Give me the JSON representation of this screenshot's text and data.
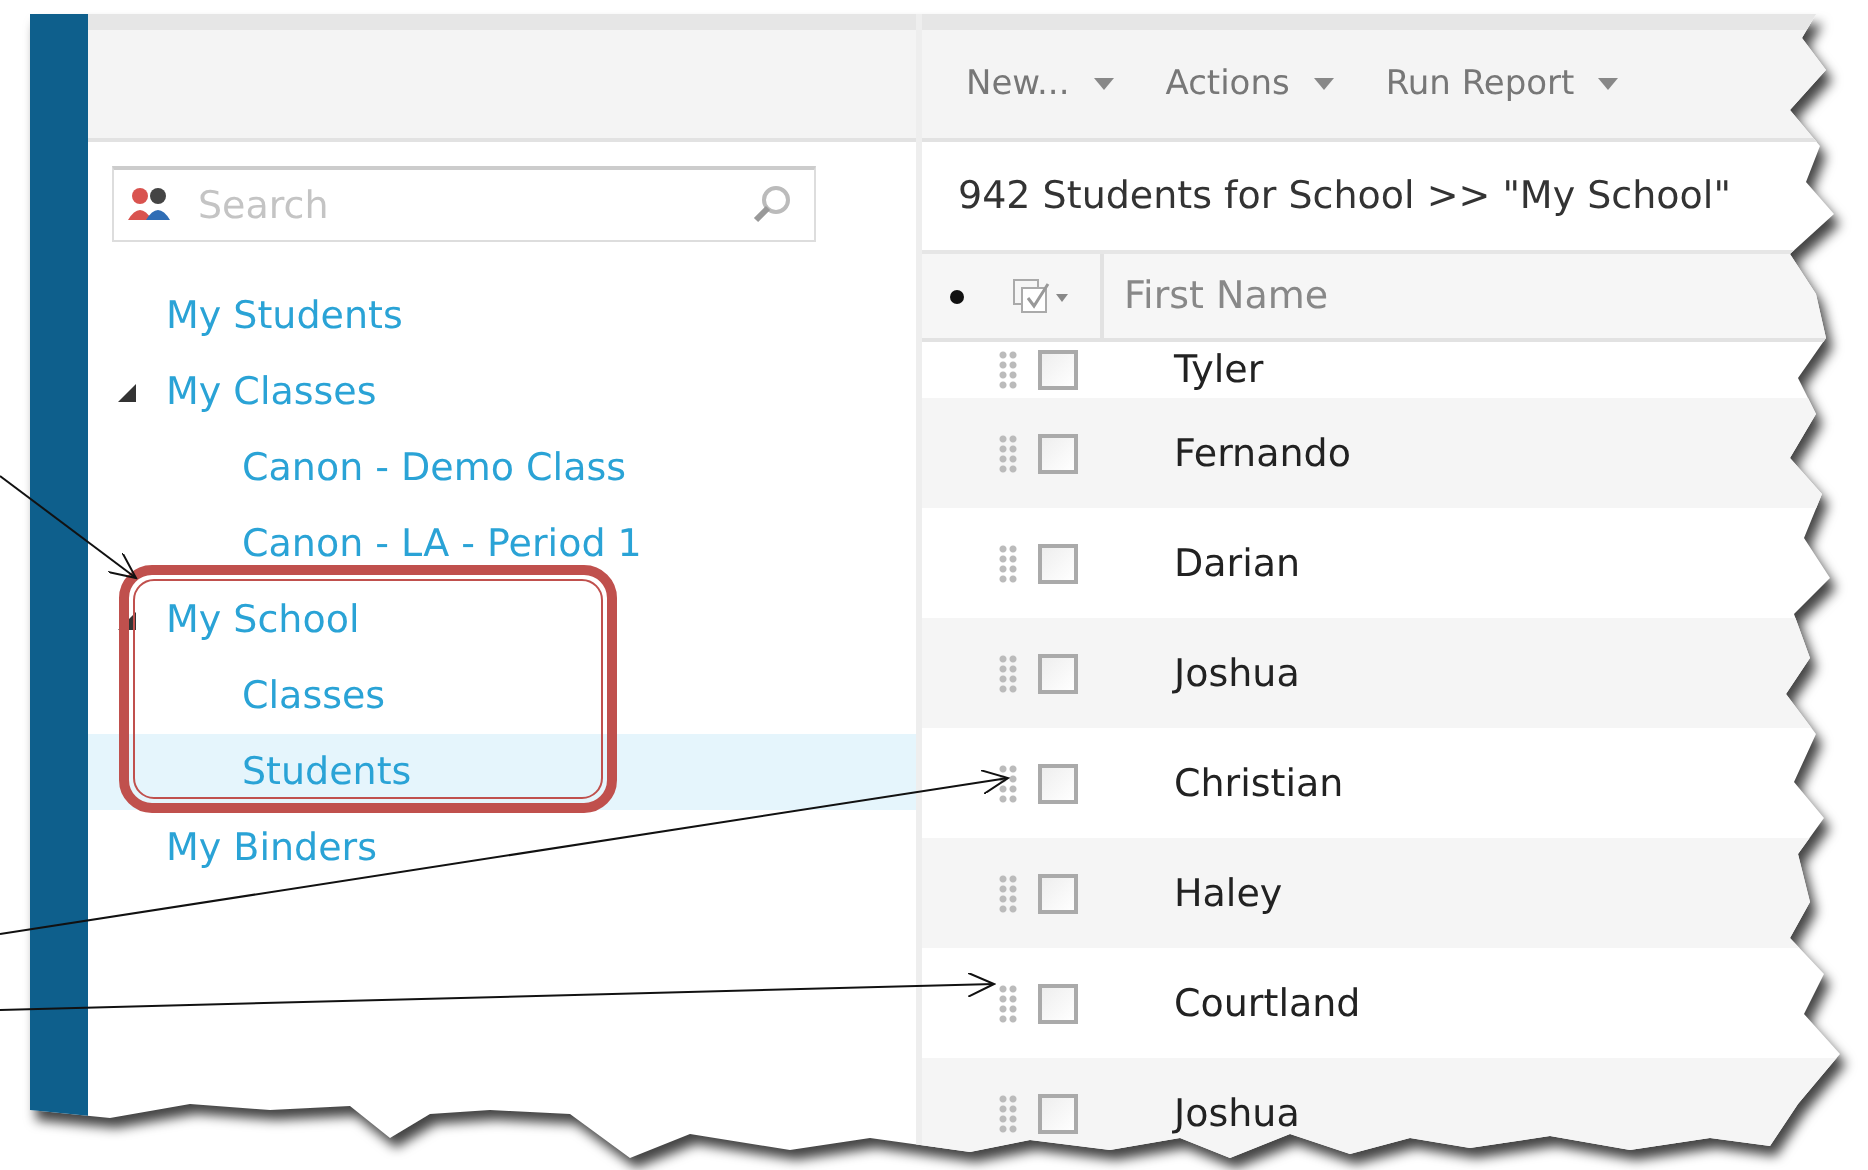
{
  "toolbar": {
    "menus": [
      {
        "label": "New..."
      },
      {
        "label": "Actions"
      },
      {
        "label": "Run Report"
      }
    ]
  },
  "sidebar": {
    "search": {
      "placeholder": "Search"
    },
    "tree": [
      {
        "label": "My Students",
        "selected": false
      },
      {
        "label": "My Classes",
        "selected": false,
        "expanded": true,
        "children": [
          {
            "label": "Canon - Demo Class",
            "selected": false
          },
          {
            "label": "Canon - LA - Period 1",
            "selected": false
          }
        ]
      },
      {
        "label": "My School",
        "selected": false,
        "expanded": true,
        "children": [
          {
            "label": "Classes",
            "selected": false
          },
          {
            "label": "Students",
            "selected": true
          }
        ]
      },
      {
        "label": "My Binders",
        "selected": false
      }
    ]
  },
  "grid": {
    "title": "942 Students for School >> \"My School\"",
    "columns": [
      "First Name"
    ],
    "rows": [
      {
        "first_name": "Tyler",
        "checked": false
      },
      {
        "first_name": "Fernando",
        "checked": false
      },
      {
        "first_name": "Darian",
        "checked": false
      },
      {
        "first_name": "Joshua",
        "checked": false
      },
      {
        "first_name": "Christian",
        "checked": false
      },
      {
        "first_name": "Haley",
        "checked": false
      },
      {
        "first_name": "Courtland",
        "checked": false
      },
      {
        "first_name": "Joshua",
        "checked": false
      }
    ]
  }
}
